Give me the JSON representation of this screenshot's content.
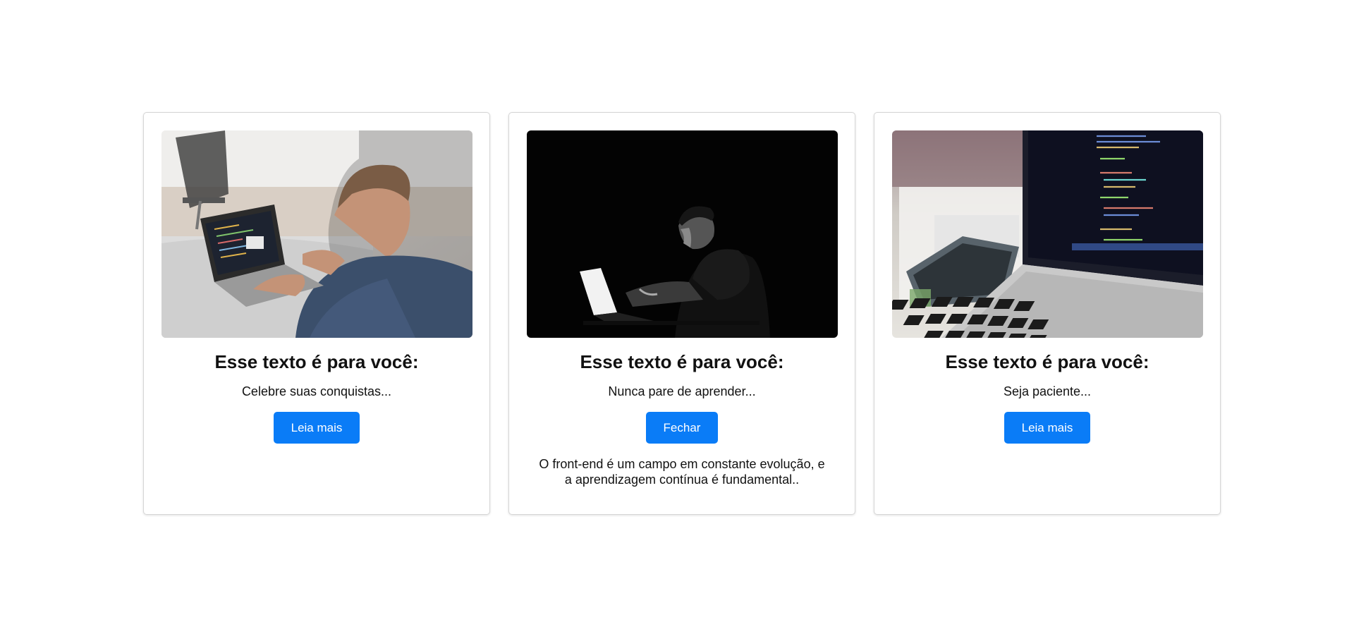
{
  "cards": [
    {
      "image_icon": "man-with-laptop-photo",
      "title": "Esse texto é para você:",
      "subtitle": "Celebre suas conquistas...",
      "button_label": "Leia mais"
    },
    {
      "image_icon": "man-in-dark-laptop-photo",
      "title": "Esse texto é para você:",
      "subtitle": "Nunca pare de aprender...",
      "button_label": "Fechar",
      "expanded_text": "O front-end é um campo em constante evolução, e a aprendizagem contínua é fundamental.."
    },
    {
      "image_icon": "laptop-code-photo",
      "title": "Esse texto é para você:",
      "subtitle": "Seja paciente...",
      "button_label": "Leia mais"
    }
  ],
  "colors": {
    "button": "#0a7cf7",
    "card_border": "#d6d6d6",
    "background": "#ffffff"
  }
}
